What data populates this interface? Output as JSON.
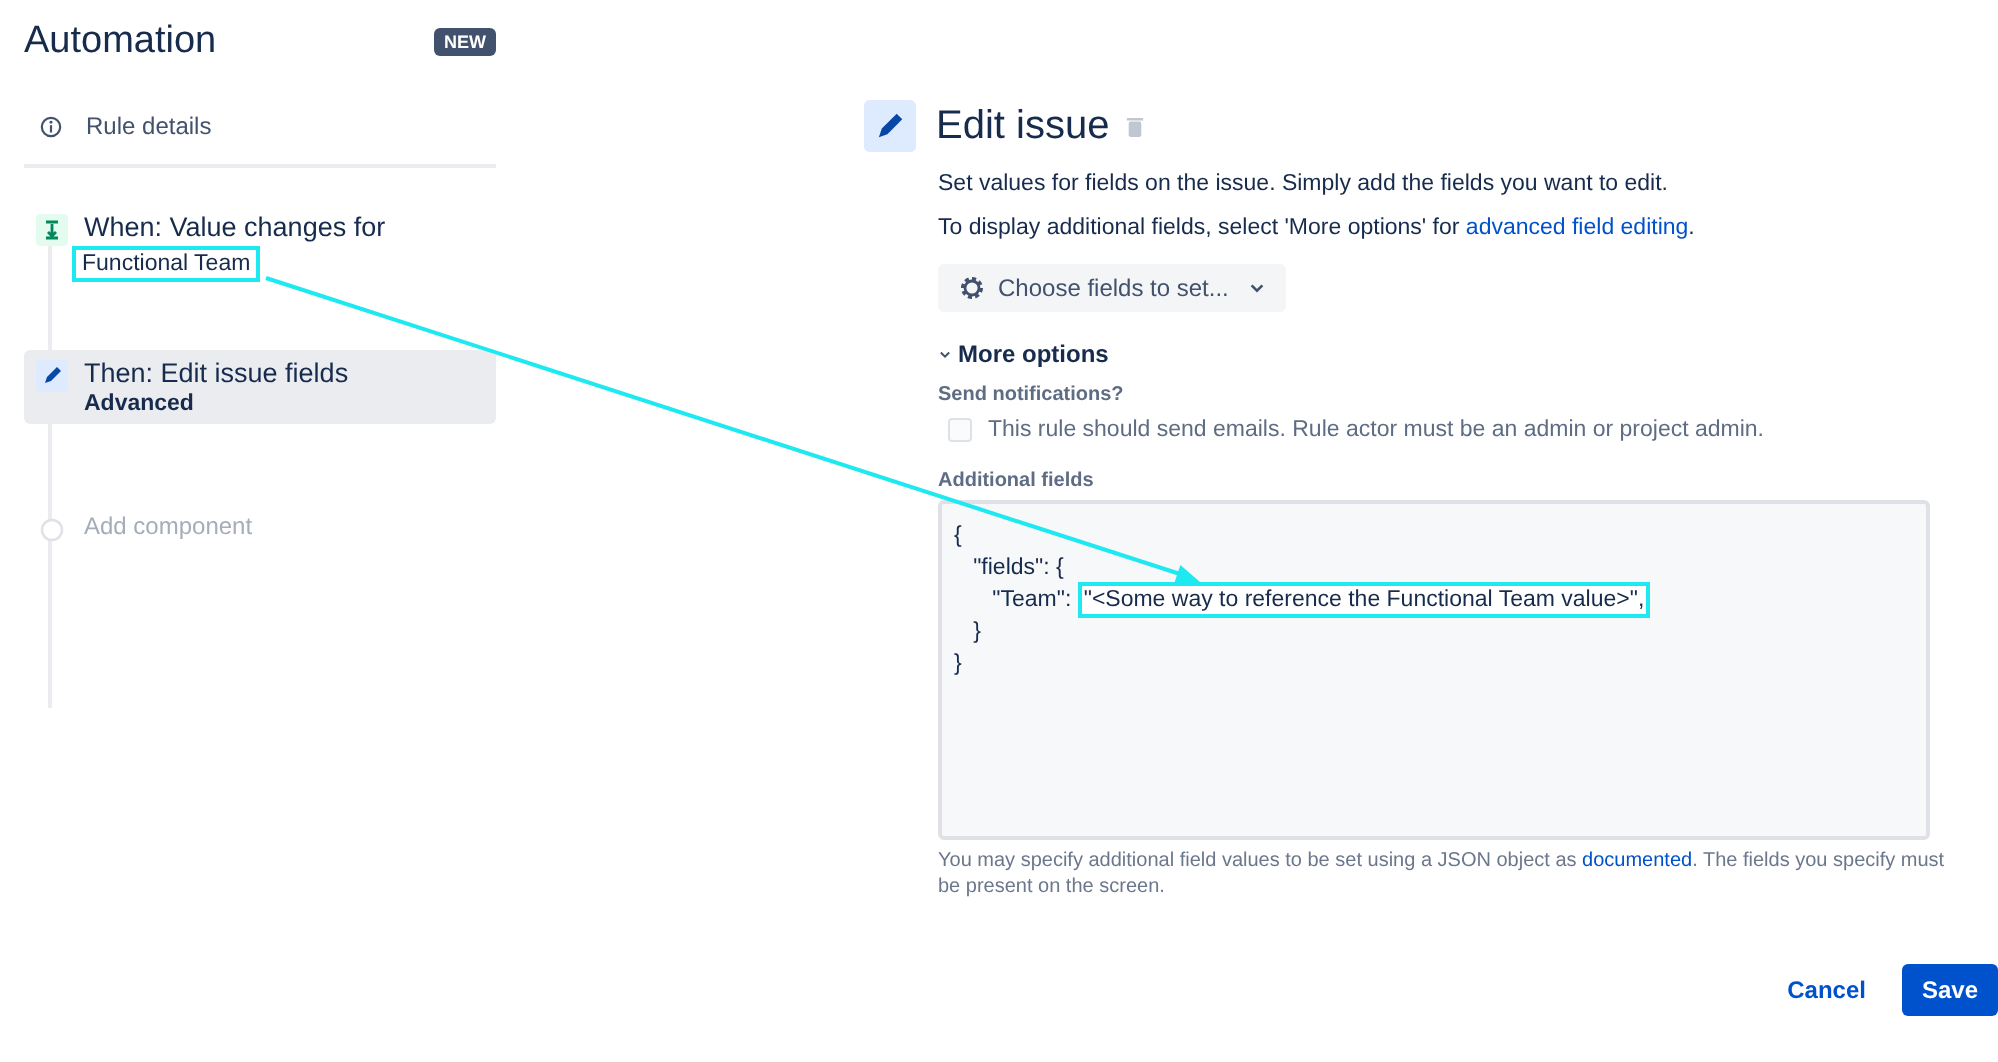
{
  "sidebar": {
    "title": "Automation",
    "badge": "NEW",
    "rule_details": "Rule details",
    "steps": [
      {
        "kind": "trigger",
        "title": "When: Value changes for",
        "subtitle": "Functional Team",
        "subtitle_highlighted": true,
        "selected": false
      },
      {
        "kind": "action",
        "title": "Then: Edit issue fields",
        "subtitle": "Advanced",
        "subtitle_highlighted": false,
        "selected": true
      },
      {
        "kind": "add",
        "title": "Add component",
        "selected": false
      }
    ]
  },
  "main": {
    "title": "Edit issue",
    "description": "Set values for fields on the issue. Simply add the fields you want to edit.",
    "hint": "To display additional fields, select 'More options' for ",
    "hint_link": "advanced field editing",
    "hint_end": ".",
    "choose_button": "Choose fields to set...",
    "more_options": "More options",
    "more_expanded": true,
    "notify_label": "Send notifications?",
    "notify_checkbox": {
      "label": "This rule should send emails. Rule actor must be an admin or project admin.",
      "checked": false
    },
    "additional_label": "Additional fields",
    "code_lines": [
      {
        "text": "{"
      },
      {
        "text": "   \"fields\": {"
      },
      {
        "text": "      \"Team\": ",
        "highlight": "\"<Some way to reference the Functional Team value>\","
      },
      {
        "text": "   }"
      },
      {
        "text": "}"
      }
    ],
    "help": "You may specify additional field values to be set using a JSON object as ",
    "help_link": "documented",
    "help_end": ". The fields you specify must be present on the screen.",
    "buttons": [
      {
        "kind": "subtle",
        "label": "Cancel"
      },
      {
        "kind": "primary",
        "label": "Save"
      }
    ]
  },
  "annotation": {
    "kind": "arrow"
  }
}
